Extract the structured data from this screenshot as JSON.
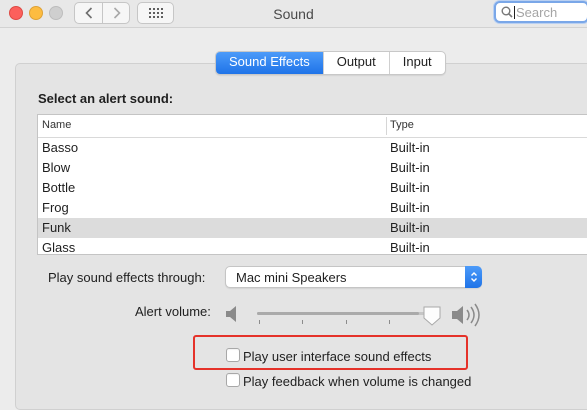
{
  "window": {
    "title": "Sound"
  },
  "search": {
    "placeholder": "Search"
  },
  "tabs": [
    {
      "label": "Sound Effects",
      "active": true
    },
    {
      "label": "Output",
      "active": false
    },
    {
      "label": "Input",
      "active": false
    }
  ],
  "alert": {
    "heading": "Select an alert sound:",
    "columns": [
      "Name",
      "Type"
    ],
    "rows": [
      {
        "name": "Basso",
        "type": "Built-in",
        "selected": false
      },
      {
        "name": "Blow",
        "type": "Built-in",
        "selected": false
      },
      {
        "name": "Bottle",
        "type": "Built-in",
        "selected": false
      },
      {
        "name": "Frog",
        "type": "Built-in",
        "selected": false
      },
      {
        "name": "Funk",
        "type": "Built-in",
        "selected": true
      },
      {
        "name": "Glass",
        "type": "Built-in",
        "selected": false
      }
    ]
  },
  "output_device": {
    "label": "Play sound effects through:",
    "value": "Mac mini Speakers"
  },
  "alert_volume": {
    "label": "Alert volume:",
    "level": 0.93
  },
  "options": {
    "ui_sounds": {
      "label": "Play user interface sound effects",
      "checked": false
    },
    "feedback": {
      "label": "Play feedback when volume is changed",
      "checked": false
    }
  },
  "colors": {
    "accent": "#1f73e8",
    "highlight_box": "#e5322a"
  },
  "icons": [
    "back-chevron-icon",
    "forward-chevron-icon",
    "grid-icon",
    "magnifier-icon",
    "speaker-low-icon",
    "speaker-high-icon",
    "popup-arrows-icon"
  ]
}
